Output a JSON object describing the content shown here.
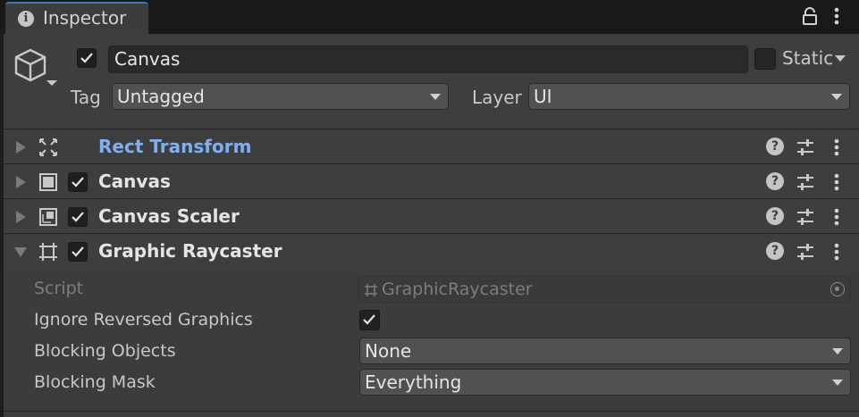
{
  "tab": {
    "title": "Inspector",
    "info_icon": "info-icon",
    "lock_icon": "lock-icon",
    "menu_icon": "kebab-menu-icon"
  },
  "gameobject": {
    "icon": "cube-icon",
    "active": true,
    "name": "Canvas",
    "static_label": "Static",
    "static_checked": false,
    "tag_label": "Tag",
    "tag_value": "Untagged",
    "layer_label": "Layer",
    "layer_value": "UI"
  },
  "components": [
    {
      "title": "Rect Transform",
      "icon": "rect-transform-icon",
      "has_toggle": false,
      "expanded": false
    },
    {
      "title": "Canvas",
      "icon": "canvas-icon",
      "has_toggle": true,
      "enabled": true,
      "expanded": false
    },
    {
      "title": "Canvas Scaler",
      "icon": "canvas-scaler-icon",
      "has_toggle": true,
      "enabled": true,
      "expanded": false
    },
    {
      "title": "Graphic Raycaster",
      "icon": "graphic-raycaster-icon",
      "has_toggle": true,
      "enabled": true,
      "expanded": true
    }
  ],
  "graphic_raycaster": {
    "script_label": "Script",
    "script_value": "GraphicRaycaster",
    "ignore_reversed_label": "Ignore Reversed Graphics",
    "ignore_reversed_value": true,
    "blocking_objects_label": "Blocking Objects",
    "blocking_objects_value": "None",
    "blocking_mask_label": "Blocking Mask",
    "blocking_mask_value": "Everything"
  },
  "colors": {
    "accent_blue": "#7fb0ef",
    "tab_highlight": "#3a79bb",
    "panel_bg": "#3c3c3c"
  }
}
